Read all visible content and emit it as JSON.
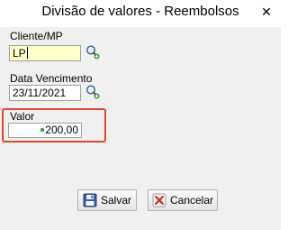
{
  "window": {
    "title": "Divisão de valores - Reembolsos",
    "close_glyph": "✕"
  },
  "form": {
    "client_label": "Cliente/MP",
    "client_value": "LP",
    "due_date_label": "Data Vencimento",
    "due_date_value": "23/11/2021",
    "value_label": "Valor",
    "value_value": "200,00"
  },
  "icons": {
    "search": "search-add-icon",
    "save": "floppy-disk-icon",
    "cancel": "red-x-icon",
    "currency": "money-icon"
  },
  "buttons": {
    "save_label": "Salvar",
    "cancel_label": "Cancelar"
  },
  "colors": {
    "highlight": "#e8442a",
    "input_yellow": "#ffffc8",
    "dialog_bg": "#f0f0f0"
  }
}
